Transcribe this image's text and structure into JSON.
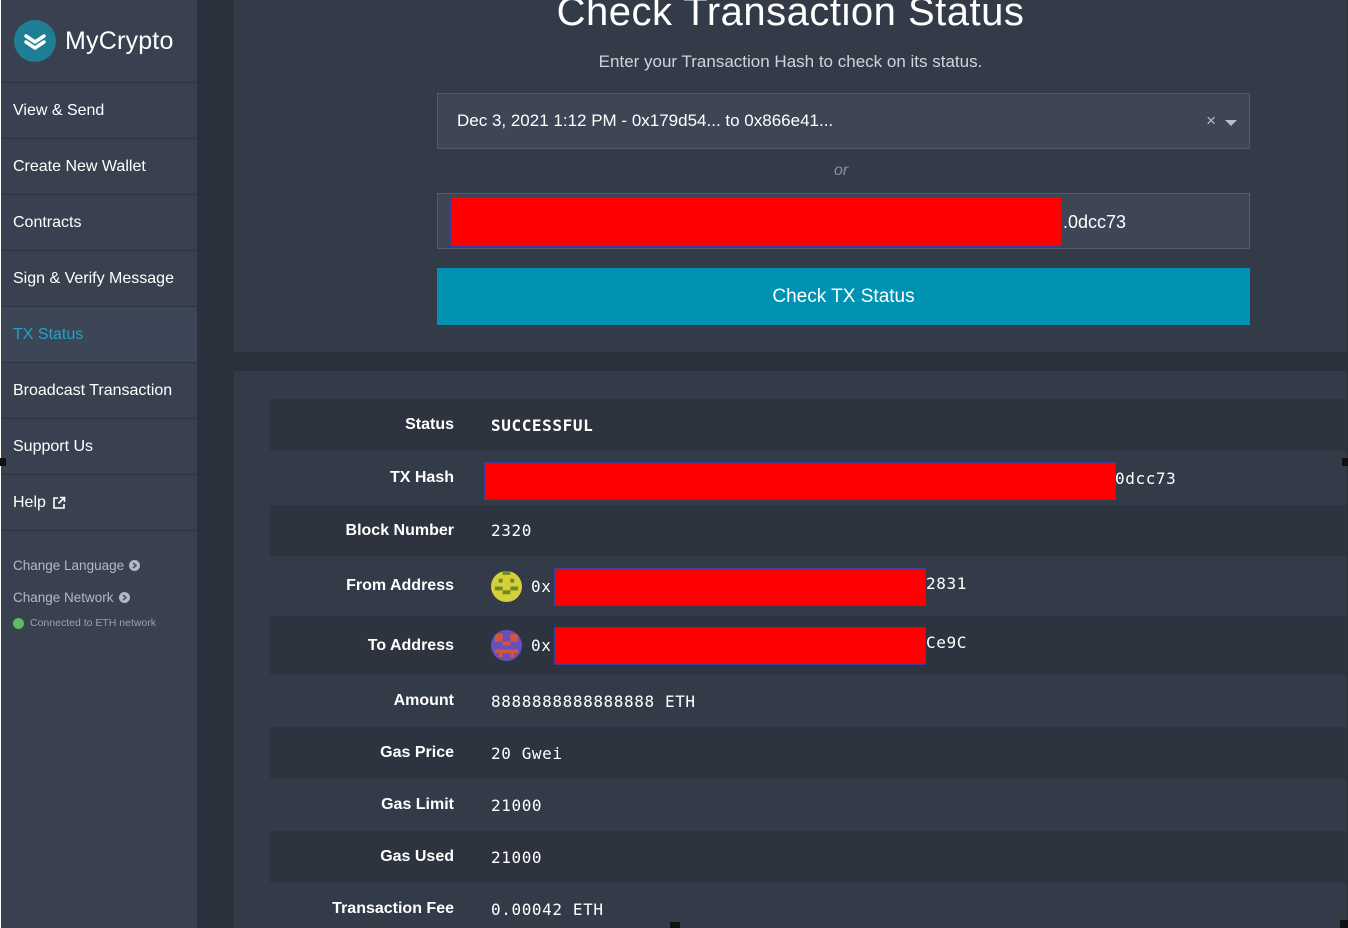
{
  "brand": {
    "name": "MyCrypto"
  },
  "nav": {
    "items": [
      {
        "label": "View & Send"
      },
      {
        "label": "Create New Wallet"
      },
      {
        "label": "Contracts"
      },
      {
        "label": "Sign & Verify Message"
      },
      {
        "label": "TX Status"
      },
      {
        "label": "Broadcast Transaction"
      },
      {
        "label": "Support Us"
      },
      {
        "label": "Help"
      }
    ],
    "active": "TX Status",
    "change_language": "Change Language",
    "change_network": "Change Network",
    "network_status": "Connected to ETH network"
  },
  "page": {
    "title": "Check Transaction Status",
    "subtitle": "Enter your Transaction Hash to check on its status.",
    "recent_tx_select": "Dec 3, 2021 1:12 PM - 0x179d54... to 0x866e41...",
    "or": "or",
    "hash_input_visible_tail": ".0dcc73",
    "check_button": "Check TX Status"
  },
  "tx": {
    "status_label": "Status",
    "status_value": "SUCCESSFUL",
    "hash_label": "TX Hash",
    "hash_visible_tail": "0dcc73",
    "block_label": "Block Number",
    "block_value": "2320",
    "from_label": "From Address",
    "from_prefix": "0x",
    "from_tail": "2831",
    "to_label": "To Address",
    "to_prefix": "0x",
    "to_tail": "Ce9C",
    "amount_label": "Amount",
    "amount_value": "8888888888888888 ETH",
    "gas_price_label": "Gas Price",
    "gas_price_value": "20 Gwei",
    "gas_limit_label": "Gas Limit",
    "gas_limit_value": "21000",
    "gas_used_label": "Gas Used",
    "gas_used_value": "21000",
    "fee_label": "Transaction Fee",
    "fee_value": "0.00042 ETH"
  },
  "colors": {
    "accent": "#0092b3",
    "active_nav": "#1fa3c9",
    "success": "#6dbb6f",
    "redaction": "#ff0000"
  }
}
